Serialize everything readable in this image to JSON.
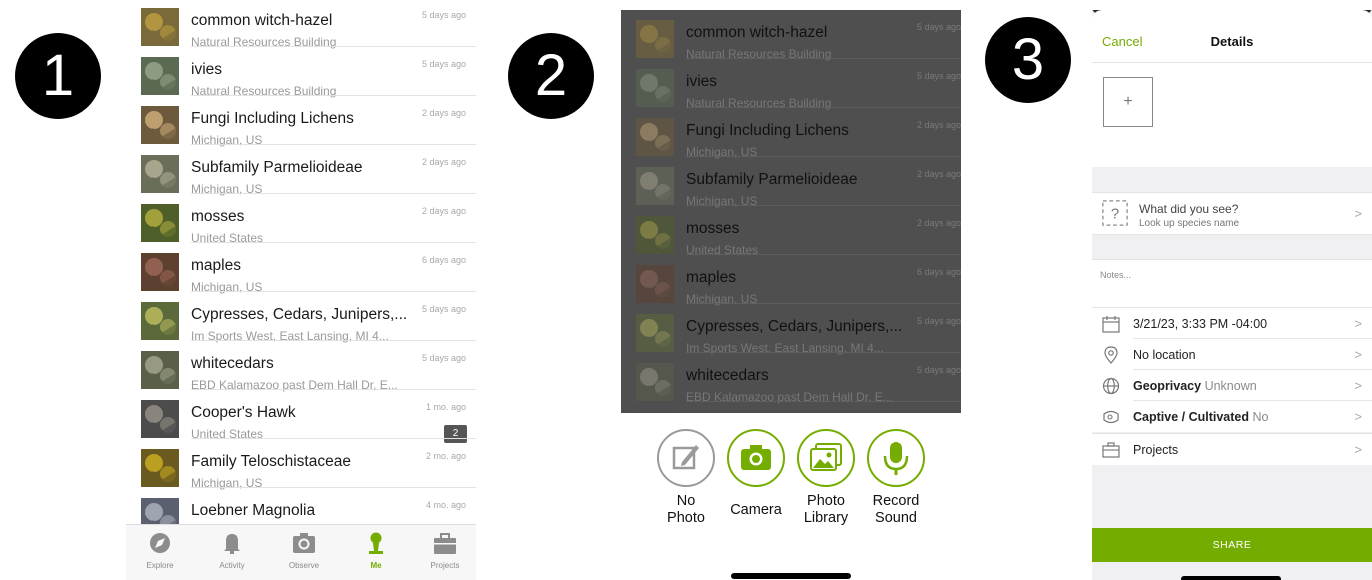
{
  "steps": [
    "1",
    "2",
    "3"
  ],
  "colors": {
    "accent": "#74ac00",
    "dim_overlay": "#4f4f4f"
  },
  "observations": [
    {
      "title": "common witch-hazel",
      "place": "Natural Resources Building",
      "when": "5 days ago",
      "thumb": "witch-hazel-photo"
    },
    {
      "title": "ivies",
      "place": "Natural Resources Building",
      "when": "5 days ago",
      "thumb": "ivy-photo"
    },
    {
      "title": "Fungi Including Lichens",
      "place": "Michigan, US",
      "when": "2 days ago",
      "thumb": "lichen-photo"
    },
    {
      "title": "Subfamily Parmelioideae",
      "place": "Michigan, US",
      "when": "2 days ago",
      "thumb": "parmelioideae-photo"
    },
    {
      "title": "mosses",
      "place": "United States",
      "when": "2 days ago",
      "thumb": "moss-photo"
    },
    {
      "title": "maples",
      "place": "Michigan, US",
      "when": "6 days ago",
      "thumb": "maple-photo"
    },
    {
      "title": "Cypresses, Cedars, Junipers,...",
      "place": "Im Sports West, East Lansing, MI 4...",
      "when": "5 days ago",
      "thumb": "cypress-photo"
    },
    {
      "title": "whitecedars",
      "place": "EBD Kalamazoo past Dem Hall Dr, E...",
      "when": "5 days ago",
      "thumb": "whitecedar-photo"
    },
    {
      "title": "Cooper's Hawk",
      "place": "United States",
      "when": "1 mo. ago",
      "thumb": "hawk-photo",
      "comments": "2"
    },
    {
      "title": "Family Teloschistaceae",
      "place": "Michigan, US",
      "when": "2 mo. ago",
      "thumb": "teloschistaceae-photo"
    },
    {
      "title": "Loebner Magnolia",
      "place": "",
      "when": "4 mo. ago",
      "thumb": "magnolia-photo"
    }
  ],
  "tabbar": {
    "tabs": [
      {
        "label": "Explore",
        "icon": "compass-icon"
      },
      {
        "label": "Activity",
        "icon": "bell-icon"
      },
      {
        "label": "Observe",
        "icon": "camera-icon"
      },
      {
        "label": "Me",
        "icon": "person-icon",
        "active": true
      },
      {
        "label": "Projects",
        "icon": "briefcase-icon"
      }
    ]
  },
  "observe_sheet": {
    "options": [
      {
        "label_line1": "No",
        "label_line2": "Photo",
        "icon": "pencil-icon"
      },
      {
        "label_line1": "Camera",
        "label_line2": "",
        "icon": "camera-icon"
      },
      {
        "label_line1": "Photo",
        "label_line2": "Library",
        "icon": "photo-library-icon"
      },
      {
        "label_line1": "Record",
        "label_line2": "Sound",
        "icon": "microphone-icon"
      }
    ]
  },
  "details": {
    "cancel": "Cancel",
    "title": "Details",
    "add_photo": "+",
    "what_did_you_see": "What did you see?",
    "lookup": "Look up species name",
    "notes_placeholder": "Notes...",
    "date": "3/21/23, 3:33 PM -04:00",
    "location": "No location",
    "geoprivacy_label": "Geoprivacy",
    "geoprivacy_value": "Unknown",
    "captive_label": "Captive / Cultivated",
    "captive_value": "No",
    "projects": "Projects",
    "share": "SHARE",
    "chevron": ">"
  }
}
